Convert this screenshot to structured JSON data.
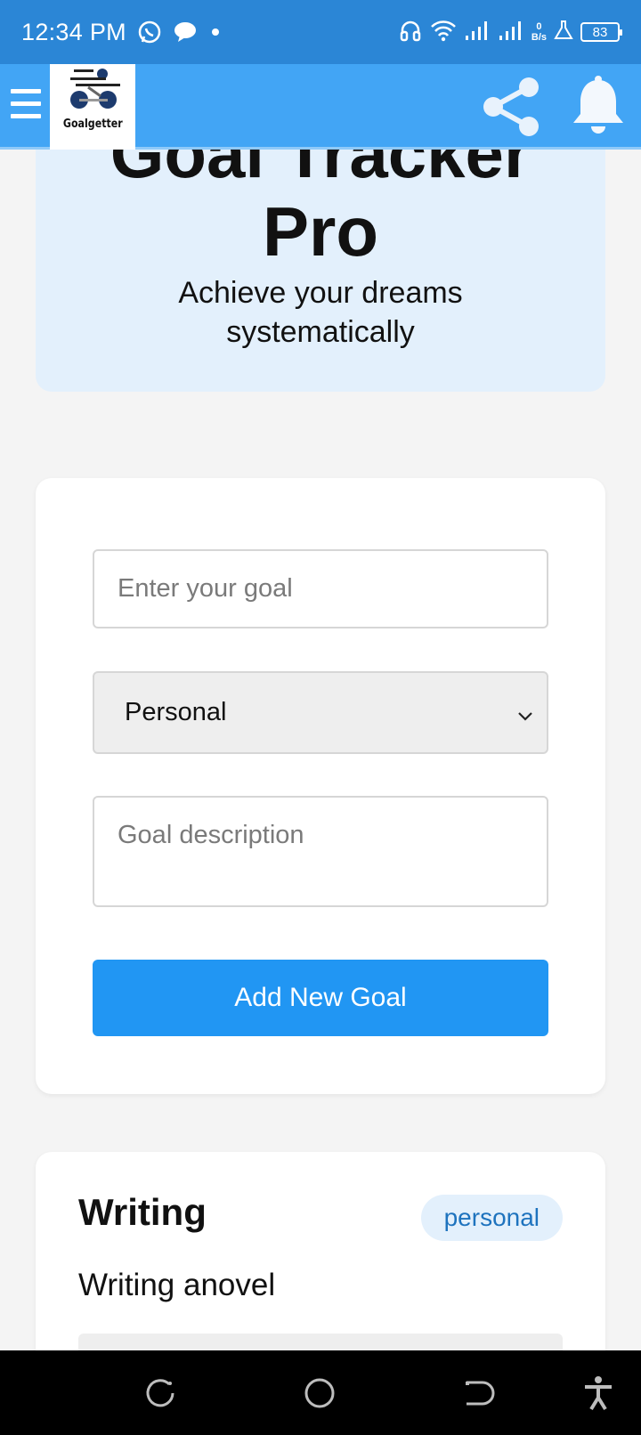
{
  "status_bar": {
    "time": "12:34 PM",
    "net_speed_value": "0",
    "net_speed_unit": "B/s",
    "battery": "83",
    "icons": [
      "whatsapp-icon",
      "chat-bubble-icon",
      "dot-icon",
      "headphones-icon",
      "wifi-icon",
      "signal-icon",
      "signal-icon",
      "flask-icon",
      "battery-icon"
    ]
  },
  "app_bar": {
    "logo_text": "Goalgetter",
    "menu_icon": "hamburger-menu-icon",
    "share_icon": "share-icon",
    "bell_icon": "bell-icon",
    "color": "#42a5f5"
  },
  "hero": {
    "title_line1": "Goal Tracker",
    "title_line2": "Pro",
    "subtitle_line1": "Achieve your dreams",
    "subtitle_line2": "systematically"
  },
  "form": {
    "goal_placeholder": "Enter your goal",
    "category_selected": "Personal",
    "description_placeholder": "Goal description",
    "add_button": "Add New Goal",
    "button_color": "#2196f3"
  },
  "goals": [
    {
      "title": "Writing",
      "category": "personal",
      "description": "Writing anovel"
    }
  ],
  "nav_bar": {
    "icons": [
      "recent-apps-icon",
      "home-icon",
      "back-icon",
      "accessibility-icon"
    ]
  }
}
